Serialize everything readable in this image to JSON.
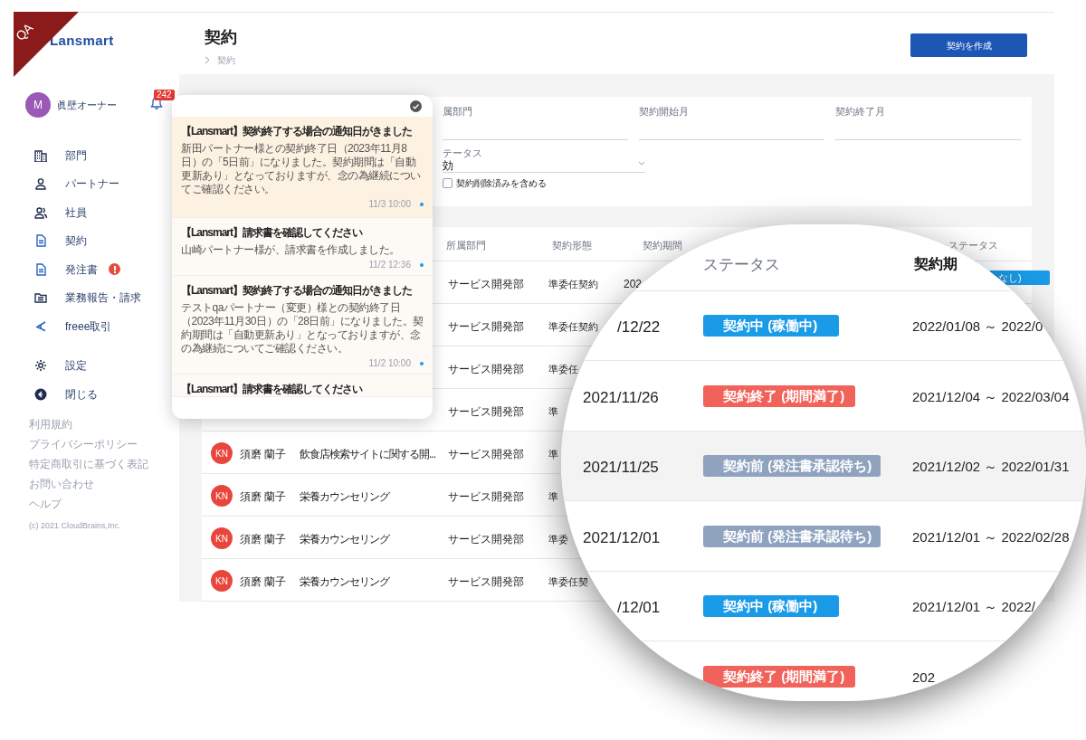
{
  "ribbon": {
    "label": "QA"
  },
  "brand": {
    "name": "Lansmart"
  },
  "user": {
    "initial": "M",
    "name": "眞壁オーナー",
    "notification_count": "242"
  },
  "sidebar": {
    "items": [
      {
        "label": "部門",
        "alert": false
      },
      {
        "label": "パートナー",
        "alert": false
      },
      {
        "label": "社員",
        "alert": false
      },
      {
        "label": "契約",
        "alert": false
      },
      {
        "label": "発注書",
        "alert": true
      },
      {
        "label": "業務報告・請求",
        "alert": false
      },
      {
        "label": "freee取引",
        "alert": false
      }
    ],
    "bottom_items": [
      {
        "label": "設定"
      },
      {
        "label": "閉じる"
      }
    ],
    "footer_links": [
      "利用規約",
      "プライバシーポリシー",
      "特定商取引に基づく表記",
      "お問い合わせ",
      "ヘルプ"
    ],
    "copyright": "(c) 2021 CloudBrains,Inc."
  },
  "header": {
    "title": "契約",
    "breadcrumb": "契約",
    "create_button": "契約を作成"
  },
  "filters": {
    "fields": [
      {
        "label": "属部門"
      },
      {
        "label": "契約開始月"
      },
      {
        "label": "契約終了月"
      }
    ],
    "status": {
      "label": "テータス",
      "value": "効"
    },
    "include_deleted": {
      "label": "契約削除済みを含める",
      "checked": false
    }
  },
  "table": {
    "columns": [
      "所属部門",
      "契約形態",
      "契約期間",
      "ステータス"
    ],
    "rows": [
      {
        "department": "サービス開発部",
        "contract_type": "準委任契約",
        "period": "202",
        "status": "なし)"
      },
      {
        "department": "サービス開発部",
        "contract_type": "準委任契約"
      },
      {
        "department": "サービス開発部",
        "contract_type": "準委任"
      },
      {
        "department": "サービス開発部",
        "contract_type": "準"
      },
      {
        "initials": "KN",
        "name": "須磨 蘭子",
        "project": "飲食店検索サイトに関する開...",
        "department": "サービス開発部",
        "contract_type": "準"
      },
      {
        "initials": "KN",
        "name": "須磨 蘭子",
        "project": "栄養カウンセリング",
        "department": "サービス開発部",
        "contract_type": "準"
      },
      {
        "initials": "KN",
        "name": "須磨 蘭子",
        "project": "栄養カウンセリング",
        "department": "サービス開発部",
        "contract_type": "準委"
      },
      {
        "initials": "KN",
        "name": "須磨 蘭子",
        "project": "栄養カウンセリング",
        "department": "サービス開発部",
        "contract_type": "準委任契"
      }
    ]
  },
  "notifications": [
    {
      "title": "【Lansmart】契約終了する場合の通知日がきました",
      "body": "新田パートナー様との契約終了日（2023年11月8日）の「5日前」になりました。契約期間は「自動更新あり」となっておりますが、念の為継続についてご確認ください。",
      "time": "11/3 10:00",
      "unread": true,
      "highlighted": true
    },
    {
      "title": "【Lansmart】請求書を確認してください",
      "body": "山崎パートナー様が、請求書を作成しました。",
      "time": "11/2 12:36",
      "unread": true,
      "highlighted": false
    },
    {
      "title": "【Lansmart】契約終了する場合の通知日がきました",
      "body": "テストqaパートナー（変更）様との契約終了日（2023年11月30日）の「28日前」になりました。契約期間は「自動更新あり」となっておりますが、念の為継続についてご確認ください。",
      "time": "11/2 10:00",
      "unread": true,
      "highlighted": false
    },
    {
      "title": "【Lansmart】請求書を確認してください",
      "highlighted": false
    }
  ],
  "magnifier": {
    "columns": [
      "ステータス",
      "契約期"
    ],
    "rows": [
      {
        "date": "/12/22",
        "status": {
          "label": "契約中 (稼働中)",
          "kind": "active"
        },
        "period": "2022/01/08 ～ 2022/0",
        "highlighted": false
      },
      {
        "date": "2021/11/26",
        "status": {
          "label": "契約終了 (期間満了)",
          "kind": "ended"
        },
        "period": "2021/12/04 ～ 2022/03/04",
        "highlighted": false
      },
      {
        "date": "2021/11/25",
        "status": {
          "label": "契約前 (発注書承認待ち)",
          "kind": "pending"
        },
        "period": "2021/12/02 ～ 2022/01/31",
        "highlighted": true
      },
      {
        "date": "2021/12/01",
        "status": {
          "label": "契約前 (発注書承認待ち)",
          "kind": "pending"
        },
        "period": "2021/12/01 ～ 2022/02/28",
        "highlighted": false
      },
      {
        "date": "/12/01",
        "status": {
          "label": "契約中 (稼働中)",
          "kind": "active"
        },
        "period": "2021/12/01 ～ 2022/",
        "highlighted": false
      },
      {
        "status": {
          "label": "契約終了 (期間満了)",
          "kind": "ended"
        },
        "period": "202",
        "highlighted": false
      }
    ]
  }
}
